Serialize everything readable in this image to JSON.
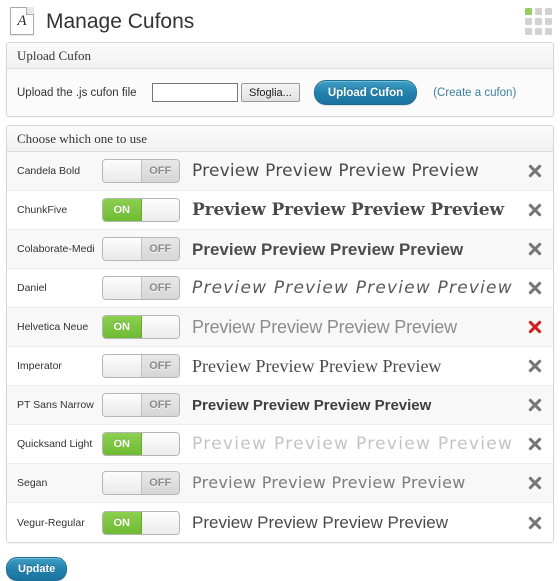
{
  "header": {
    "title": "Manage Cufons",
    "doc_icon_glyph": "A",
    "grid_icon_accent": "#93ce5e"
  },
  "upload_panel": {
    "heading": "Upload Cufon",
    "field_label": "Upload the .js cufon file",
    "file_value": "",
    "browse_label": "Sfoglia...",
    "upload_button": "Upload Cufon",
    "create_link": "(Create a cufon)",
    "accent_color": "#2482ad"
  },
  "list_panel": {
    "heading": "Choose which one to use",
    "preview_text": "Preview Preview Preview Preview",
    "toggle_on_label": "ON",
    "toggle_off_label": "OFF",
    "on_color": "#6fbb33",
    "delete_hover_color": "#d01f1f",
    "rows": [
      {
        "name": "Candela Bold",
        "state": "OFF",
        "preview": "Preview Preview Preview Preview",
        "style": "pv-candela",
        "delete_state": "normal"
      },
      {
        "name": "ChunkFive",
        "state": "ON",
        "preview": "Preview Preview Preview Preview",
        "style": "pv-chunk",
        "delete_state": "normal"
      },
      {
        "name": "Colaborate-Medi",
        "state": "OFF",
        "preview": "Preview Preview Preview Preview",
        "style": "pv-colab",
        "delete_state": "normal"
      },
      {
        "name": "Daniel",
        "state": "OFF",
        "preview": "Preview Preview Preview Preview",
        "style": "pv-daniel",
        "delete_state": "normal"
      },
      {
        "name": "Helvetica Neue",
        "state": "ON",
        "preview": "Preview Preview Preview Preview",
        "style": "pv-helv",
        "delete_state": "hover"
      },
      {
        "name": "Imperator",
        "state": "OFF",
        "preview": "Preview Preview Preview Preview",
        "style": "pv-imper",
        "delete_state": "normal"
      },
      {
        "name": "PT Sans Narrow",
        "state": "OFF",
        "preview": "Preview Preview Preview Preview",
        "style": "pv-ptsans",
        "delete_state": "normal"
      },
      {
        "name": "Quicksand Light",
        "state": "ON",
        "preview": "Preview Preview Preview Preview",
        "style": "pv-quick",
        "delete_state": "normal"
      },
      {
        "name": "Segan",
        "state": "OFF",
        "preview": "Preview Preview Preview Preview",
        "style": "pv-segan",
        "delete_state": "normal"
      },
      {
        "name": "Vegur-Regular",
        "state": "ON",
        "preview": "Preview Preview Preview Preview",
        "style": "pv-vegur",
        "delete_state": "normal"
      }
    ]
  },
  "footer": {
    "update_label": "Update"
  }
}
